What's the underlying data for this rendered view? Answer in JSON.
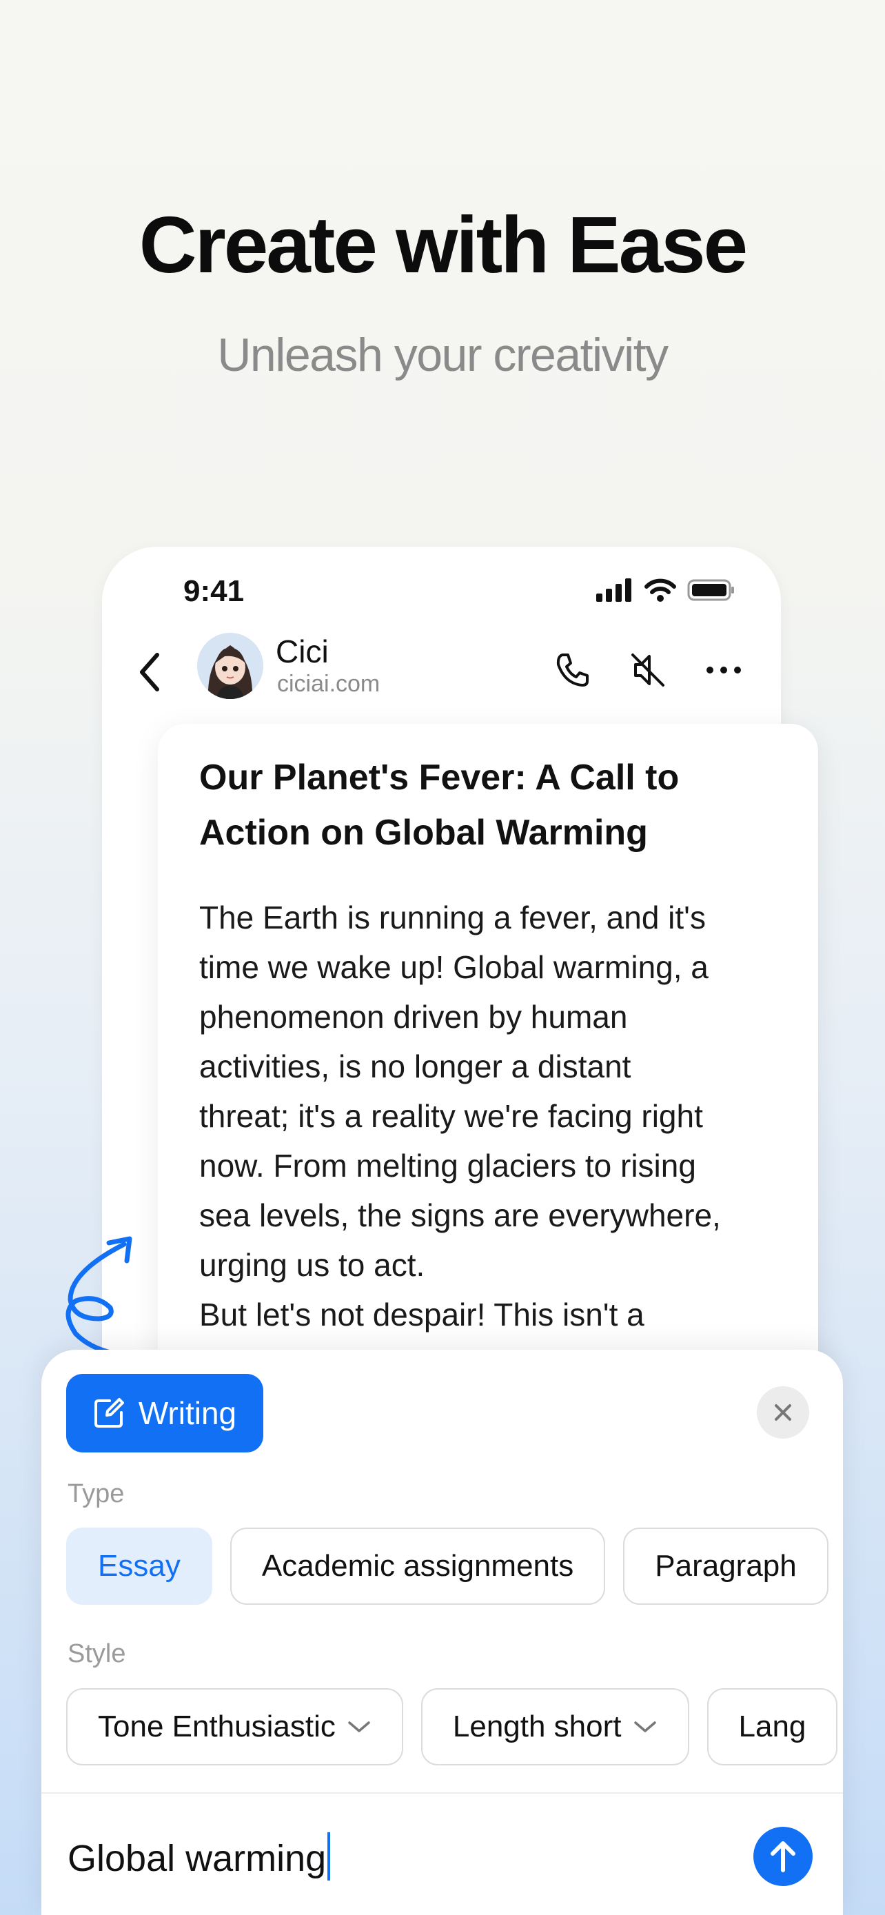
{
  "hero": {
    "title": "Create with Ease",
    "subtitle": "Unleash your creativity"
  },
  "status_bar": {
    "time": "9:41",
    "icons": [
      "signal-icon",
      "wifi-icon",
      "battery-icon"
    ]
  },
  "chat_header": {
    "name": "Cici",
    "domain": "ciciai.com",
    "icons": [
      "back-icon",
      "phone-icon",
      "mute-icon",
      "more-icon"
    ]
  },
  "article": {
    "title": "Our Planet's Fever: A Call to Action on Global Warming",
    "body": "The Earth is running a fever, and it's\ntime we wake up! Global warming, a\nphenomenon driven by human\nactivities, is no longer a distant\nthreat; it's a reality we're facing right\nnow. From melting glaciers to rising\nsea levels, the signs are everywhere,\nurging us to act.\nBut let's not despair! This isn't a"
  },
  "panel": {
    "mode_label": "Writing",
    "type_label": "Type",
    "types": [
      "Essay",
      "Academic assignments",
      "Paragraph"
    ],
    "selected_type": "Essay",
    "style_label": "Style",
    "styles": [
      "Tone Enthusiastic",
      "Length short",
      "Lang"
    ],
    "input_value": "Global warming"
  },
  "colors": {
    "accent": "#1270f5",
    "selected_chip_bg": "#e3eefc",
    "subtitle": "#8a8a8a"
  }
}
